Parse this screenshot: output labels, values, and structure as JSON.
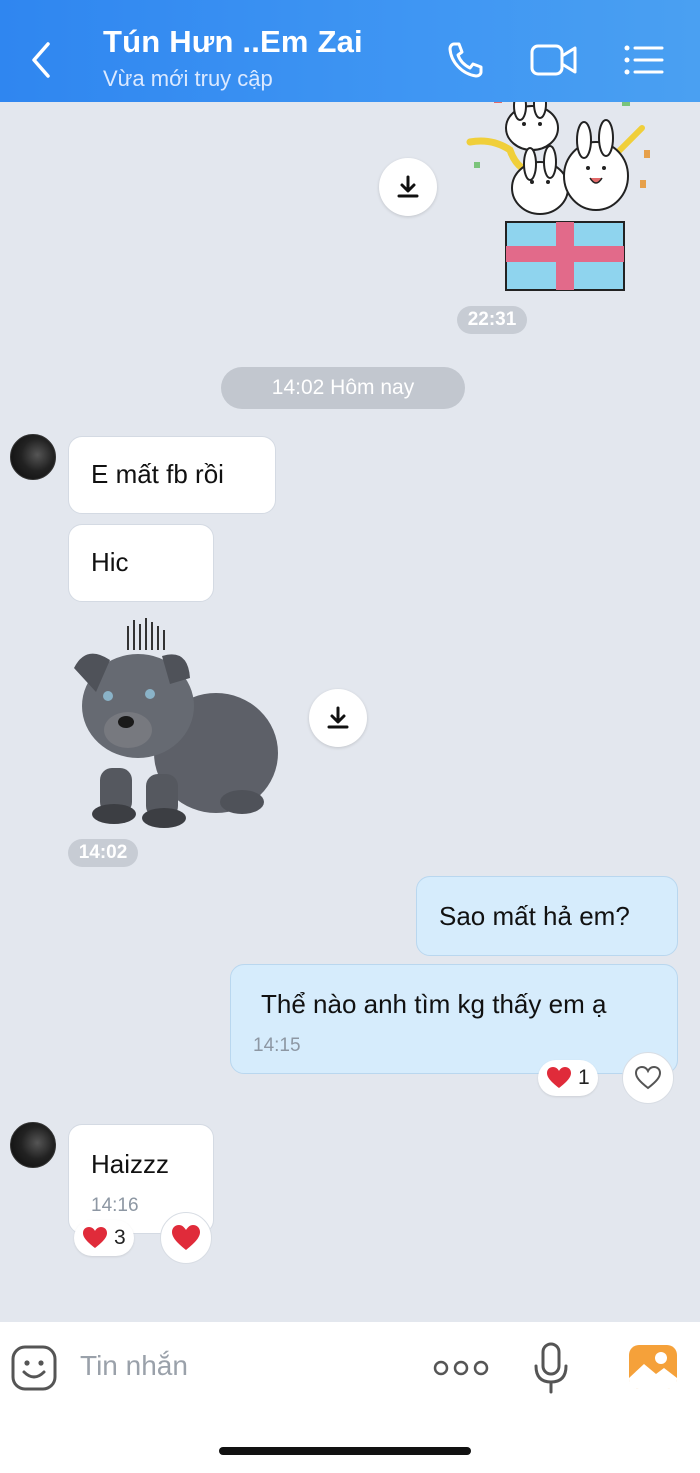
{
  "header": {
    "title": "Tún Hưn ..Em Zai",
    "status": "Vừa mới truy cập",
    "icons": [
      "back-arrow",
      "phone",
      "video-camera",
      "menu-list"
    ],
    "color": "#3a90f2"
  },
  "messages": {
    "sticker_gift_time": "22:31",
    "date_separator": "14:02 Hôm nay",
    "msg1": "E mất fb rồi",
    "msg2": "Hic",
    "sticker_dog_time": "14:02",
    "msg3": "Sao mất hả em?",
    "msg4": "Thể nào anh tìm kg thấy em ạ",
    "msg4_time": "14:15",
    "msg4_reaction_count": "1",
    "msg5": "Haizzz",
    "msg5_time": "14:16",
    "msg5_reaction_count": "3"
  },
  "input": {
    "placeholder": "Tin nhắn",
    "icons": [
      "sticker-face",
      "more-dots",
      "microphone",
      "photo"
    ]
  }
}
